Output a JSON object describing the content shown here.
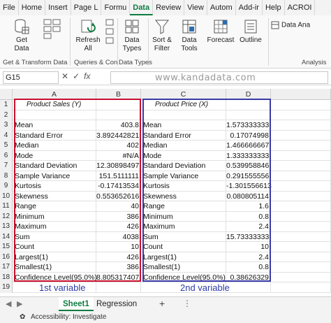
{
  "ribbon_tabs": [
    "File",
    "Home",
    "Insert",
    "Page L",
    "Formu",
    "Data",
    "Review",
    "View",
    "Autom",
    "Add-ir",
    "Help",
    "ACROI"
  ],
  "active_tab_index": 5,
  "ribbon": {
    "get_data": "Get\nData",
    "refresh_all": "Refresh\nAll",
    "data_types": "Data\nTypes",
    "sort_filter": "Sort &\nFilter",
    "data_tools": "Data\nTools",
    "forecast": "Forecast",
    "outline": "Outline",
    "data_analysis": "Data Ana",
    "groups": {
      "get_transform": "Get & Transform Data",
      "queries": "Queries & Con",
      "data_types": "Data Types",
      "analysis": "Analysis"
    }
  },
  "formula_bar": {
    "name_box": "G15",
    "fx_label": "fx",
    "value": ""
  },
  "watermark": "www.kandadata.com",
  "columns": [
    "A",
    "B",
    "C",
    "D"
  ],
  "rows": [
    {
      "n": "1",
      "a": "Product Sales (Y)",
      "b": "",
      "c": "Product Price (X)",
      "d": ""
    },
    {
      "n": "2",
      "a": "",
      "b": "",
      "c": "",
      "d": ""
    },
    {
      "n": "3",
      "a": "Mean",
      "b": "403.8",
      "c": "Mean",
      "d": "1.573333333"
    },
    {
      "n": "4",
      "a": "Standard Error",
      "b": "3.892442821",
      "c": "Standard Error",
      "d": "0.17074998"
    },
    {
      "n": "5",
      "a": "Median",
      "b": "402",
      "c": "Median",
      "d": "1.466666667"
    },
    {
      "n": "6",
      "a": "Mode",
      "b": "#N/A",
      "c": "Mode",
      "d": "1.333333333"
    },
    {
      "n": "7",
      "a": "Standard Deviation",
      "b": "12.30898497",
      "c": "Standard Deviation",
      "d": "0.539958846"
    },
    {
      "n": "8",
      "a": "Sample Variance",
      "b": "151.5111111",
      "c": "Sample Variance",
      "d": "0.291555556"
    },
    {
      "n": "9",
      "a": "Kurtosis",
      "b": "-0.17413534",
      "c": "Kurtosis",
      "d": "-1.301556613"
    },
    {
      "n": "10",
      "a": "Skewness",
      "b": "0.553652616",
      "c": "Skewness",
      "d": "0.080805114"
    },
    {
      "n": "11",
      "a": "Range",
      "b": "40",
      "c": "Range",
      "d": "1.6"
    },
    {
      "n": "12",
      "a": "Minimum",
      "b": "386",
      "c": "Minimum",
      "d": "0.8"
    },
    {
      "n": "13",
      "a": "Maximum",
      "b": "426",
      "c": "Maximum",
      "d": "2.4"
    },
    {
      "n": "14",
      "a": "Sum",
      "b": "4038",
      "c": "Sum",
      "d": "15.73333333"
    },
    {
      "n": "15",
      "a": "Count",
      "b": "10",
      "c": "Count",
      "d": "10"
    },
    {
      "n": "16",
      "a": "Largest(1)",
      "b": "426",
      "c": "Largest(1)",
      "d": "2.4"
    },
    {
      "n": "17",
      "a": "Smallest(1)",
      "b": "386",
      "c": "Smallest(1)",
      "d": "0.8"
    },
    {
      "n": "18",
      "a": "Confidence Level(95.0%)",
      "b": "8.805317407",
      "c": "Confidence Level(95.0%)",
      "d": "0.38626329"
    },
    {
      "n": "19",
      "a": "",
      "b": "",
      "c": "",
      "d": ""
    }
  ],
  "annotations": {
    "first": "1st variable",
    "second": "2nd variable",
    "first_color": "#c8102e",
    "second_color": "#3a3aa8"
  },
  "sheets": [
    "Sheet1",
    "Regression"
  ],
  "active_sheet_index": 0,
  "sheet_add": "+",
  "sheet_more": "⋮",
  "status": {
    "accessibility": "Accessibility: Investigate"
  },
  "icons": [
    "database-icon",
    "refresh-icon",
    "data-types-icon",
    "filter-icon",
    "data-tools-icon",
    "forecast-icon",
    "outline-icon",
    "analysis-icon",
    "fx-icon",
    "accessibility-icon"
  ]
}
